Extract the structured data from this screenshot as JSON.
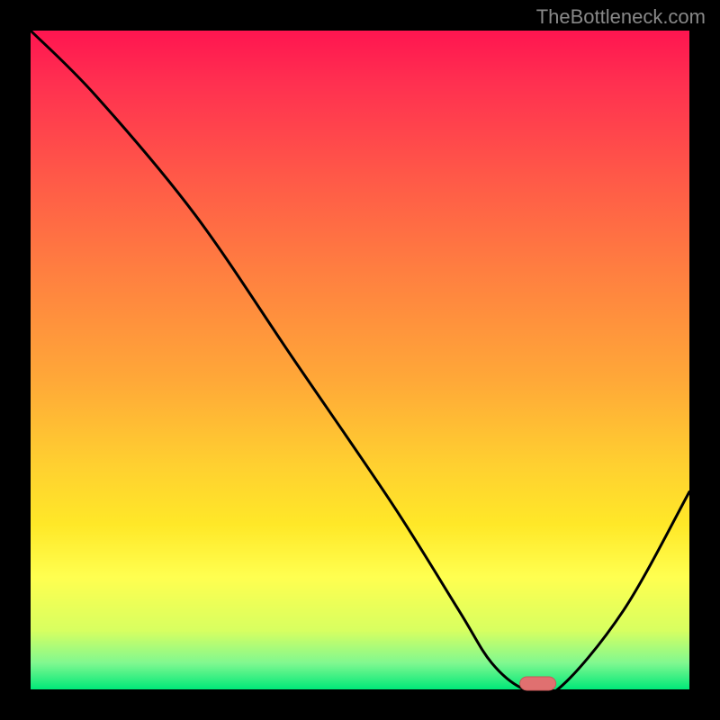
{
  "watermark": "TheBottleneck.com",
  "chart_data": {
    "type": "line",
    "title": "",
    "xlabel": "",
    "ylabel": "",
    "xlim": [
      0,
      100
    ],
    "ylim": [
      0,
      100
    ],
    "series": [
      {
        "name": "curve",
        "x": [
          0,
          10,
          25,
          40,
          55,
          65,
          70,
          75,
          80,
          90,
          100
        ],
        "values": [
          100,
          90,
          72,
          50,
          28,
          12,
          4,
          0,
          0,
          12,
          30
        ]
      }
    ],
    "marker": {
      "x": 77,
      "y": 0,
      "color": "#E07070"
    },
    "grid": false,
    "legend": false
  }
}
